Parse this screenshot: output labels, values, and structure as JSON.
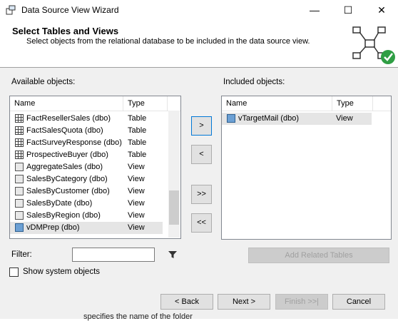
{
  "window": {
    "title": "Data Source View Wizard",
    "minimize_glyph": "—",
    "maximize_glyph": "☐",
    "close_glyph": "✕"
  },
  "header": {
    "title": "Select Tables and Views",
    "subtitle": "Select objects from the relational database to be included in the data source view."
  },
  "available": {
    "label": "Available objects:",
    "columns": {
      "name": "Name",
      "type": "Type"
    },
    "rows": [
      {
        "name": "FactResellerSales (dbo)",
        "type": "Table",
        "icon": "table-icon"
      },
      {
        "name": "FactSalesQuota (dbo)",
        "type": "Table",
        "icon": "table-icon"
      },
      {
        "name": "FactSurveyResponse (dbo)",
        "type": "Table",
        "icon": "table-icon"
      },
      {
        "name": "ProspectiveBuyer (dbo)",
        "type": "Table",
        "icon": "table-icon"
      },
      {
        "name": "AggregateSales (dbo)",
        "type": "View",
        "icon": "view-icon"
      },
      {
        "name": "SalesByCategory (dbo)",
        "type": "View",
        "icon": "view-icon"
      },
      {
        "name": "SalesByCustomer (dbo)",
        "type": "View",
        "icon": "view-icon"
      },
      {
        "name": "SalesByDate (dbo)",
        "type": "View",
        "icon": "view-icon"
      },
      {
        "name": "SalesByRegion (dbo)",
        "type": "View",
        "icon": "view-icon"
      },
      {
        "name": "vDMPrep (dbo)",
        "type": "View",
        "icon": "view-icon",
        "selected": true
      }
    ]
  },
  "included": {
    "label": "Included objects:",
    "columns": {
      "name": "Name",
      "type": "Type"
    },
    "rows": [
      {
        "name": "vTargetMail (dbo)",
        "type": "View",
        "icon": "view-icon",
        "selected": true
      }
    ]
  },
  "move_buttons": {
    "add": ">",
    "remove": "<",
    "add_all": ">>",
    "remove_all": "<<"
  },
  "filter": {
    "label": "Filter:",
    "value": "",
    "filter_icon": "funnel-icon"
  },
  "add_related_label": "Add Related Tables",
  "show_system_label": "Show system objects",
  "show_system_checked": false,
  "footer": {
    "back": "< Back",
    "next": "Next >",
    "finish": "Finish >>|",
    "cancel": "Cancel",
    "behind_text": "specifies the name of the folder"
  },
  "colors": {
    "accent": "#0078d7",
    "check_green": "#2f9e44",
    "body_bg": "#f0f0f0"
  }
}
